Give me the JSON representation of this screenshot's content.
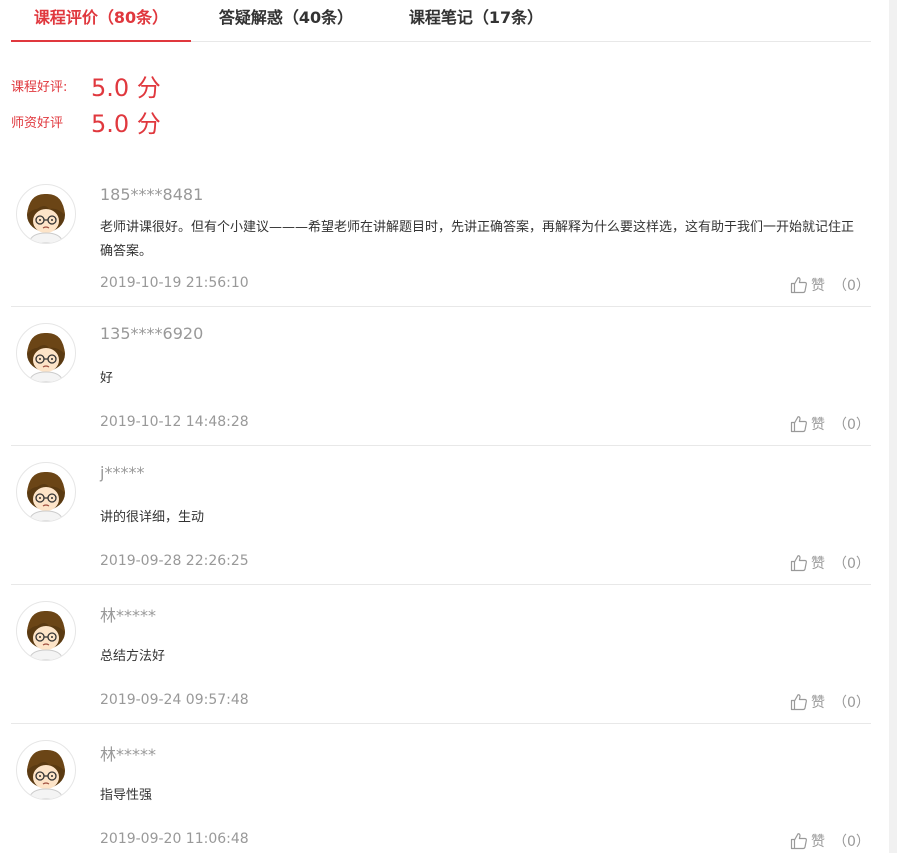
{
  "tabs": [
    {
      "label": "课程评价（80条）",
      "active": true
    },
    {
      "label": "答疑解惑（40条）",
      "active": false
    },
    {
      "label": "课程笔记（17条）",
      "active": false
    }
  ],
  "ratings": [
    {
      "label": "课程好评:",
      "value": "5.0 分"
    },
    {
      "label": "师资好评",
      "value": "5.0 分"
    }
  ],
  "like_label": "赞",
  "reviews": [
    {
      "user": "185****8481",
      "text": "老师讲课很好。但有个小建议———希望老师在讲解题目时，先讲正确答案，再解释为什么要这样选，这有助于我们一开始就记住正确答案。",
      "date": "2019-10-19 21:56:10",
      "likes": "（0）"
    },
    {
      "user": "135****6920",
      "text": "好",
      "date": "2019-10-12 14:48:28",
      "likes": "（0）"
    },
    {
      "user": "j*****",
      "text": "讲的很详细，生动",
      "date": "2019-09-28 22:26:25",
      "likes": "（0）"
    },
    {
      "user": "林*****",
      "text": "总结方法好",
      "date": "2019-09-24 09:57:48",
      "likes": "（0）"
    },
    {
      "user": "林*****",
      "text": "指导性强",
      "date": "2019-09-20 11:06:48",
      "likes": "（0）"
    }
  ],
  "colors": {
    "accent": "#e0383e",
    "muted": "#999999",
    "divider": "#e8e8e8"
  }
}
